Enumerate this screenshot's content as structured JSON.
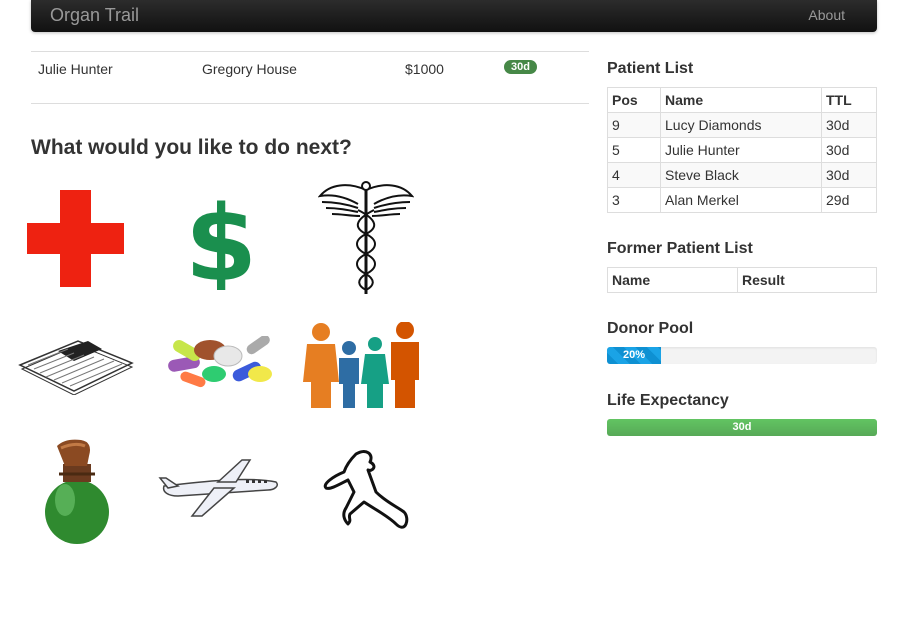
{
  "navbar": {
    "brand": "Organ Trail",
    "about": "About"
  },
  "current_patient": {
    "patient": "Julie Hunter",
    "doctor": "Gregory House",
    "money": "$1000",
    "ttl": "30d"
  },
  "prompt": "What would you like to do next?",
  "actions": [
    {
      "icon": "red-cross-icon"
    },
    {
      "icon": "dollar-icon"
    },
    {
      "icon": "caduceus-icon"
    },
    {
      "icon": "newspaper-icon"
    },
    {
      "icon": "pills-icon"
    },
    {
      "icon": "family-icon"
    },
    {
      "icon": "potion-icon"
    },
    {
      "icon": "airplane-icon"
    },
    {
      "icon": "chalk-outline-icon"
    }
  ],
  "patient_list": {
    "title": "Patient List",
    "headers": {
      "pos": "Pos",
      "name": "Name",
      "ttl": "TTL"
    },
    "rows": [
      {
        "pos": "9",
        "name": "Lucy Diamonds",
        "ttl": "30d"
      },
      {
        "pos": "5",
        "name": "Julie Hunter",
        "ttl": "30d"
      },
      {
        "pos": "4",
        "name": "Steve Black",
        "ttl": "30d"
      },
      {
        "pos": "3",
        "name": "Alan Merkel",
        "ttl": "29d"
      }
    ]
  },
  "former_patient_list": {
    "title": "Former Patient List",
    "headers": {
      "name": "Name",
      "result": "Result"
    }
  },
  "donor_pool": {
    "title": "Donor Pool",
    "label": "20%",
    "fraction": 0.2,
    "color": "#149bdf"
  },
  "life_expectancy": {
    "title": "Life Expectancy",
    "label": "30d",
    "fraction": 1.0,
    "color": "#5eb95e"
  }
}
